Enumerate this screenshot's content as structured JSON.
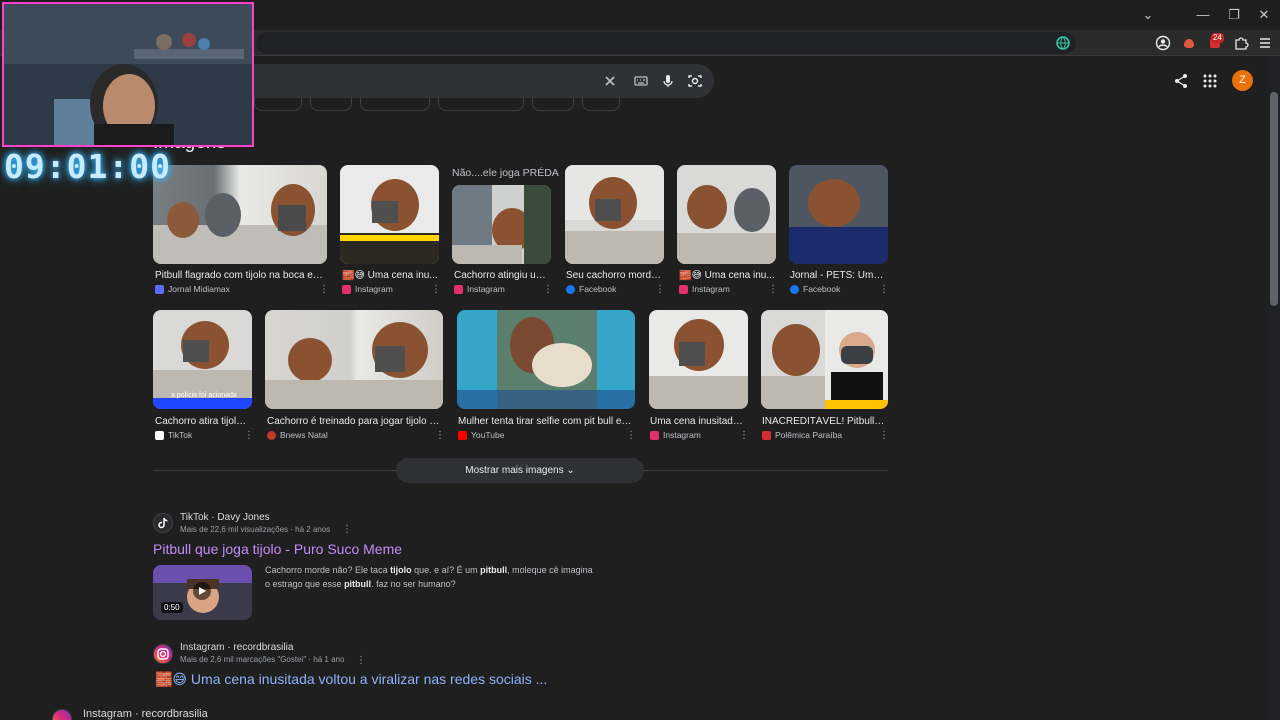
{
  "window": {
    "controls": [
      "⌄",
      "—",
      "❐",
      "✕"
    ]
  },
  "search": {
    "clear_icon": "close-icon",
    "keyboard_icon": "keyboard-icon",
    "mic_icon": "mic-icon",
    "lens_icon": "lens-icon"
  },
  "header": {
    "avatar_letter": "Z",
    "extension_badge": "24"
  },
  "timer": "09:01:00",
  "images": {
    "section_title": "Imagens",
    "overlay_text": "Não....ele joga PRÉDA",
    "row1": [
      {
        "caption": "Pitbull flagrado com tijolo na boca em t...",
        "source": "Jornal Midiamax",
        "color": "#5b6bff"
      },
      {
        "caption": "🧱😅 Uma cena inu...",
        "source": "Instagram",
        "color": "#e1306c"
      },
      {
        "caption": "Cachorro atingiu um ...",
        "source": "Instagram",
        "color": "#e1306c"
      },
      {
        "caption": "Seu cachorro morde...",
        "source": "Facebook",
        "color": "#1877f2"
      },
      {
        "caption": "🧱😅 Uma cena inu...",
        "source": "Instagram",
        "color": "#e1306c"
      },
      {
        "caption": "Jornal - PETS: Um c...",
        "source": "Facebook",
        "color": "#1877f2"
      }
    ],
    "row2": [
      {
        "caption": "Cachorro atira tijolos...",
        "source": "TikTok",
        "color": "#ffffff",
        "overlay": "a polícia foi acionada"
      },
      {
        "caption": "Cachorro é treinado para jogar tijolo em...",
        "source": "Bnews Natal",
        "color": "#c0392b"
      },
      {
        "caption": "Mulher tenta tirar selfie com pit bull e é ...",
        "source": "YouTube",
        "color": "#ff0000"
      },
      {
        "caption": "Uma cena inusitada,...",
        "source": "Instagram",
        "color": "#e1306c"
      },
      {
        "caption": "INACREDITÁVEL! Pitbull a...",
        "source": "Polêmica Paraíba",
        "color": "#d32f2f"
      }
    ],
    "more_button": "Mostrar mais imagens"
  },
  "results": [
    {
      "source": "TikTok · Davy Jones",
      "meta": "Mais de 22,6 mil visualizações · há 2 anos",
      "title": "Pitbull que joga tijolo - Puro Suco Meme",
      "duration": "0:50"
    },
    {
      "source": "Instagram · recordbrasilia",
      "meta": "Mais de 2,6 mil marcações \"Gostei\" · há 1 ano",
      "title": "Uma cena inusitada voltou a viralizar nas redes sociais ..."
    },
    {
      "source": "Instagram · recordbrasilia"
    }
  ],
  "snippet_parts": [
    "Cachorro morde não? Ele taca ",
    "tijolo",
    " que. e aí? É um ",
    "pitbull",
    ", moleque cê imagina o estrago que esse ",
    "pitbull",
    ". faz no ser humano?"
  ],
  "title_emojis": "🧱😅"
}
